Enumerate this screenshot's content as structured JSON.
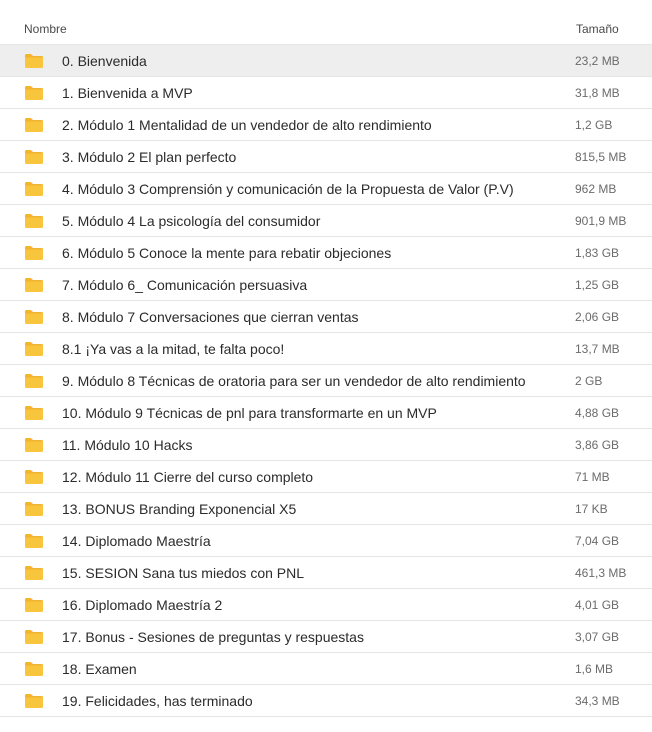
{
  "header": {
    "name_label": "Nombre",
    "size_label": "Tamaño"
  },
  "colors": {
    "folder_fill": "#f8c53d",
    "folder_tab": "#f2b431",
    "selected_row": "#eeeeee"
  },
  "icons": {
    "folder": "folder-icon"
  },
  "rows": [
    {
      "name": "0. Bienvenida",
      "size": "23,2 MB",
      "selected": true
    },
    {
      "name": "1. Bienvenida a MVP",
      "size": "31,8 MB"
    },
    {
      "name": "2. Módulo 1 Mentalidad de un vendedor de alto rendimiento",
      "size": "1,2 GB"
    },
    {
      "name": "3. Módulo 2 El plan perfecto",
      "size": "815,5 MB"
    },
    {
      "name": "4. Módulo 3 Comprensión y comunicación de la Propuesta de Valor (P.V)",
      "size": "962 MB"
    },
    {
      "name": "5. Módulo 4 La psicología del consumidor",
      "size": "901,9 MB"
    },
    {
      "name": "6. Módulo 5 Conoce la mente para rebatir objeciones",
      "size": "1,83 GB"
    },
    {
      "name": "7. Módulo 6_ Comunicación persuasiva",
      "size": "1,25 GB"
    },
    {
      "name": "8. Módulo 7 Conversaciones que cierran ventas",
      "size": "2,06 GB"
    },
    {
      "name": "8.1 ¡Ya vas a la mitad, te falta poco!",
      "size": "13,7 MB"
    },
    {
      "name": "9. Módulo 8 Técnicas de oratoria para ser un vendedor de alto rendimiento",
      "size": "2 GB"
    },
    {
      "name": "10. Módulo 9 Técnicas de pnl para transformarte en un MVP",
      "size": "4,88 GB"
    },
    {
      "name": "11. Módulo 10 Hacks",
      "size": "3,86 GB"
    },
    {
      "name": "12. Módulo 11 Cierre del curso completo",
      "size": "71 MB"
    },
    {
      "name": "13. BONUS Branding Exponencial X5",
      "size": "17 KB"
    },
    {
      "name": "14. Diplomado Maestría",
      "size": "7,04 GB"
    },
    {
      "name": "15. SESION Sana tus miedos con PNL",
      "size": "461,3 MB"
    },
    {
      "name": "16. Diplomado Maestría 2",
      "size": "4,01 GB"
    },
    {
      "name": "17. Bonus - Sesiones de preguntas y respuestas",
      "size": "3,07 GB"
    },
    {
      "name": "18. Examen",
      "size": "1,6 MB"
    },
    {
      "name": "19. Felicidades, has terminado",
      "size": "34,3 MB"
    }
  ]
}
